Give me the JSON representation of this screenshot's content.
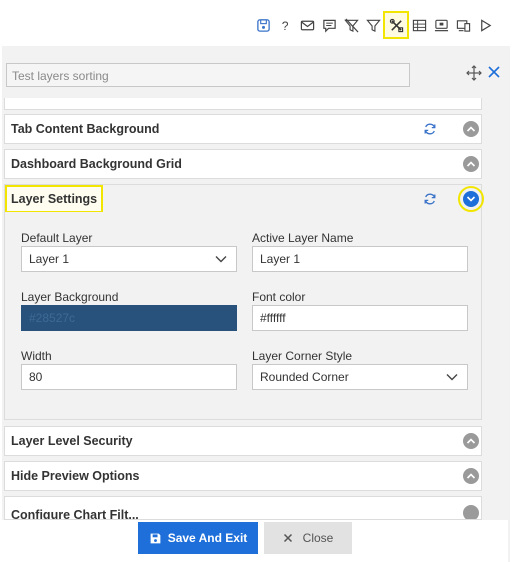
{
  "toolbar": {
    "icons": [
      "save-icon",
      "help-icon",
      "email-icon",
      "comment-icon",
      "clear-filter-icon",
      "filter-icon",
      "tools-icon",
      "table-icon",
      "screen-icon",
      "responsive-icon",
      "play-icon"
    ],
    "highlight_color": "#f2e600"
  },
  "search": {
    "placeholder": "Test layers sorting"
  },
  "sections": {
    "tab_content_background": "Tab Content Background",
    "dashboard_background_grid": "Dashboard Background Grid",
    "layer_settings": "Layer Settings",
    "layer_level_security": "Layer Level Security",
    "hide_preview_options": "Hide Preview Options",
    "configure_chart_filter": "Configure Chart Filt..."
  },
  "layer_settings": {
    "default_layer_label": "Default Layer",
    "default_layer_value": "Layer 1",
    "active_layer_name_label": "Active Layer Name",
    "active_layer_name_value": "Layer 1",
    "layer_background_label": "Layer Background",
    "layer_background_value": "#28527c",
    "font_color_label": "Font color",
    "font_color_value": "#ffffff",
    "width_label": "Width",
    "width_value": "80",
    "corner_style_label": "Layer Corner Style",
    "corner_style_value": "Rounded Corner"
  },
  "footer": {
    "save_label": "Save And Exit",
    "close_label": "Close"
  },
  "colors": {
    "accent": "#1e6fd9",
    "layer_bg": "#28527c",
    "chevron_gray": "#9a9a9a"
  }
}
